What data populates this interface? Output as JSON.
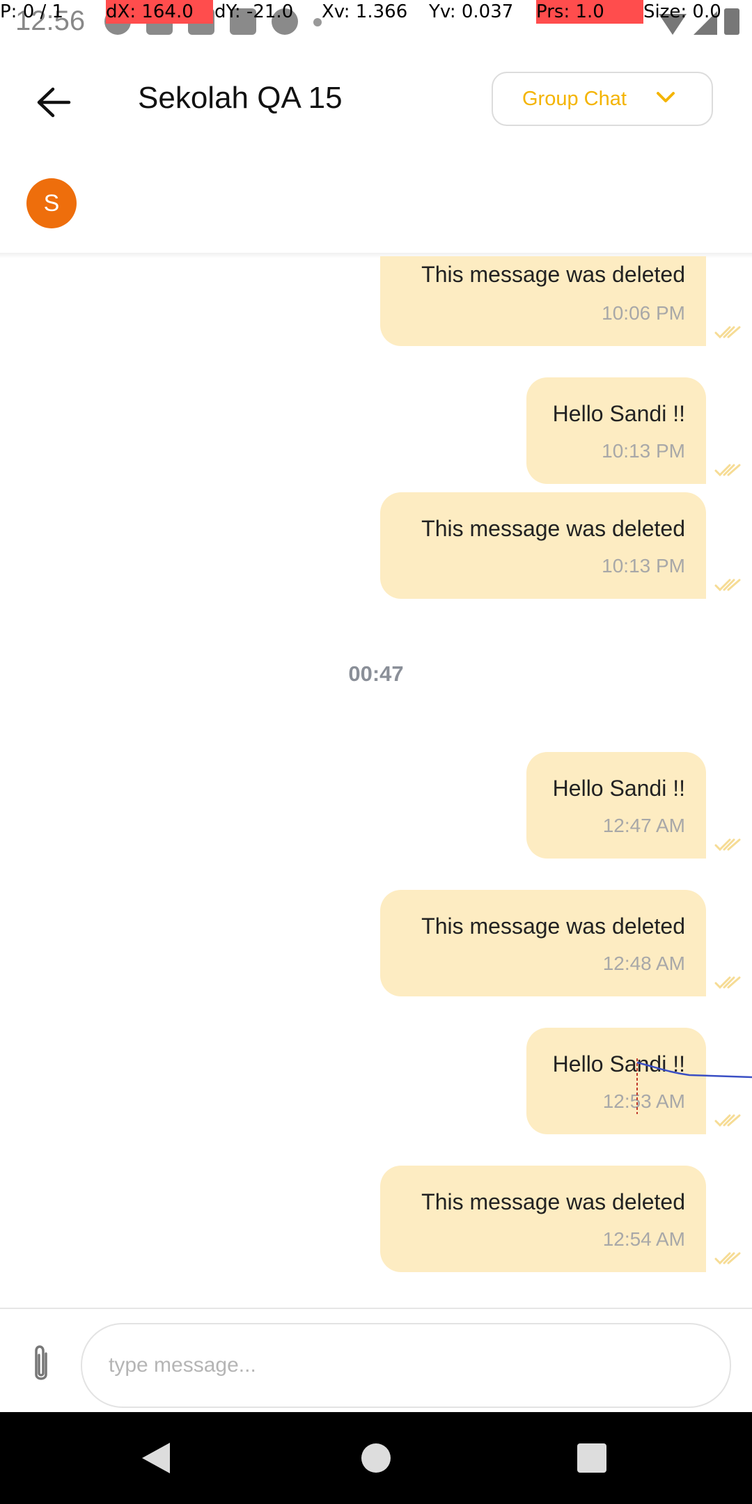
{
  "status_bar": {
    "time": "12:56"
  },
  "debug_overlay": {
    "pointer": "P: 0 / 1",
    "dx": "dX: 164.0",
    "dy": "dY: -21.0",
    "xv": "Xv: 1.366",
    "yv": "Yv: 0.037",
    "prs": "Prs: 1.0",
    "size": "Size: 0.0"
  },
  "header": {
    "title": "Sekolah QA 15",
    "dropdown_label": "Group Chat"
  },
  "members": [
    {
      "initial": "S",
      "color": "#EE6E0C"
    }
  ],
  "messages": [
    {
      "text": "This message was deleted",
      "time": "10:06 PM"
    },
    {
      "text": "Hello Sandi !!",
      "time": "10:13 PM"
    },
    {
      "text": "This message was deleted",
      "time": "10:13 PM"
    },
    {
      "text": "Hello Sandi !!",
      "time": "12:47 AM"
    },
    {
      "text": "This message was deleted",
      "time": "12:48 AM"
    },
    {
      "text": "Hello Sandi !!",
      "time": "12:53 AM"
    },
    {
      "text": "This message was deleted",
      "time": "12:54 AM"
    }
  ],
  "date_separator": "00:47",
  "input": {
    "placeholder": "type message..."
  },
  "colors": {
    "accent": "#F4B400",
    "bubble": "#FDECC2",
    "avatar": "#EE6E0C"
  }
}
